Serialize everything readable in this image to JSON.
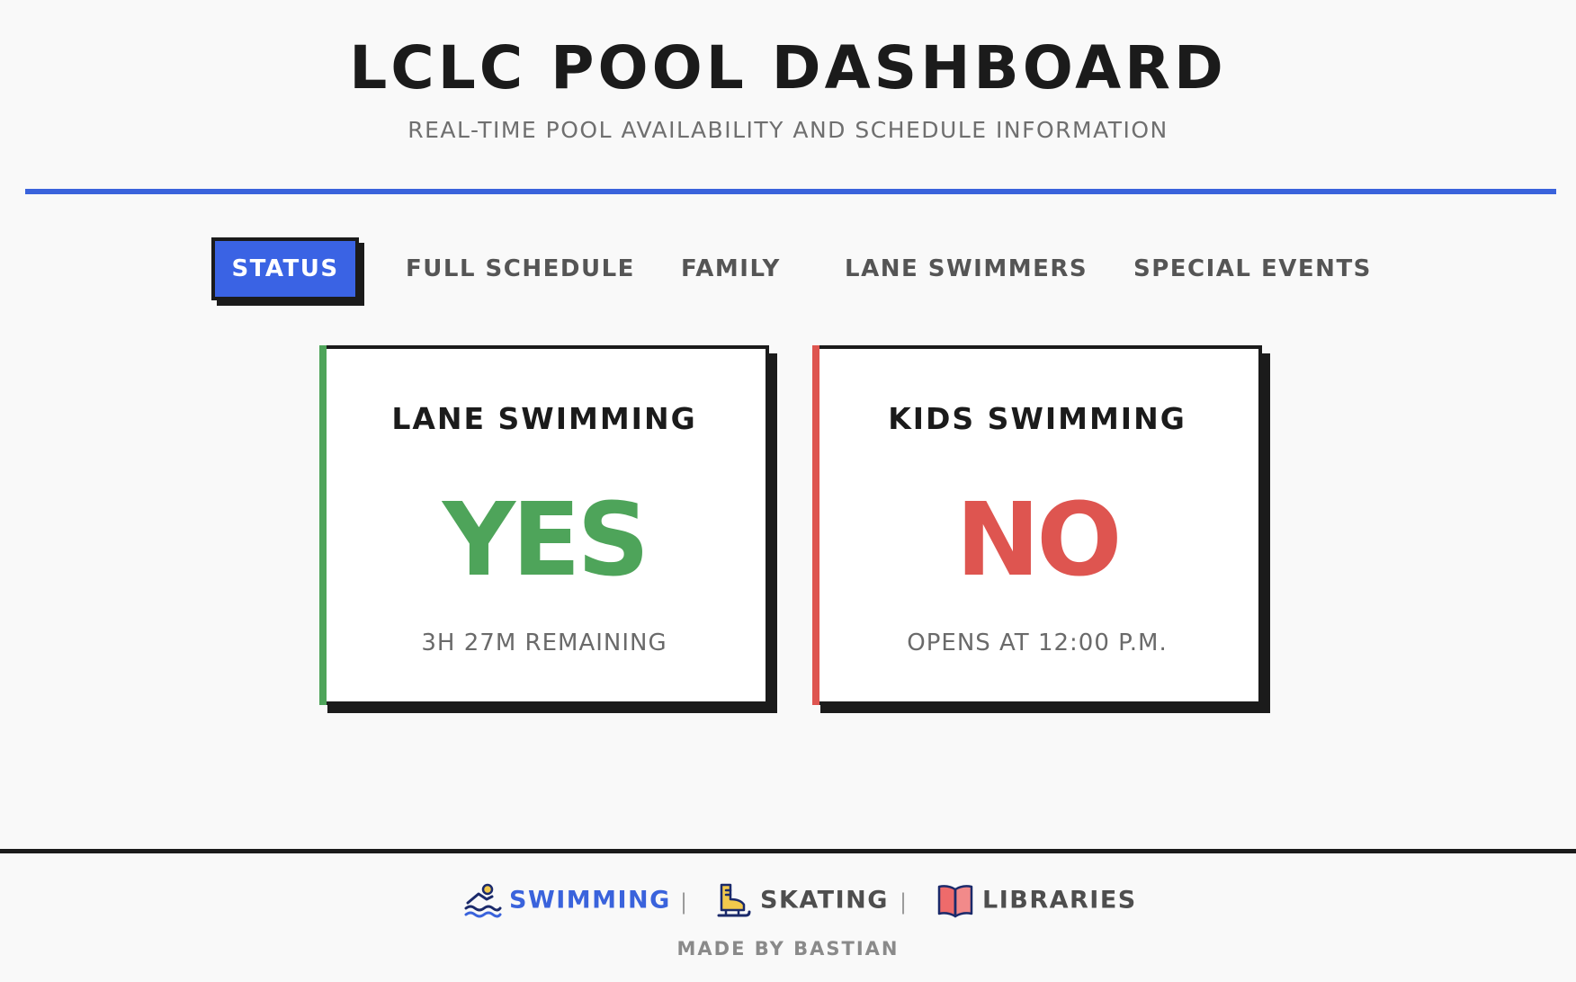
{
  "header": {
    "title": "LCLC POOL DASHBOARD",
    "subtitle": "REAL-TIME POOL AVAILABILITY AND SCHEDULE INFORMATION"
  },
  "tabs": [
    {
      "label": "STATUS",
      "active": true
    },
    {
      "label": "FULL SCHEDULE",
      "active": false
    },
    {
      "label": "FAMILY",
      "active": false
    },
    {
      "label": "LANE SWIMMERS",
      "active": false
    },
    {
      "label": "SPECIAL EVENTS",
      "active": false
    }
  ],
  "cards": [
    {
      "title": "LANE SWIMMING",
      "status": "YES",
      "detail": "3H 27M REMAINING",
      "color": "#4ea45a"
    },
    {
      "title": "KIDS SWIMMING",
      "status": "NO",
      "detail": "OPENS AT 12:00 P.M.",
      "color": "#de5550"
    }
  ],
  "footer": {
    "links": [
      {
        "label": "SWIMMING",
        "icon": "swimmer-icon",
        "active": true
      },
      {
        "label": "SKATING",
        "icon": "ice-skate-icon",
        "active": false
      },
      {
        "label": "LIBRARIES",
        "icon": "book-icon",
        "active": false
      }
    ],
    "separator": "|",
    "credit": "MADE BY BASTIAN"
  },
  "colors": {
    "accent": "#3a63dc",
    "ink": "#1b1b1b",
    "open": "#4ea45a",
    "closed": "#de5550",
    "background": "#f9f9f9"
  }
}
